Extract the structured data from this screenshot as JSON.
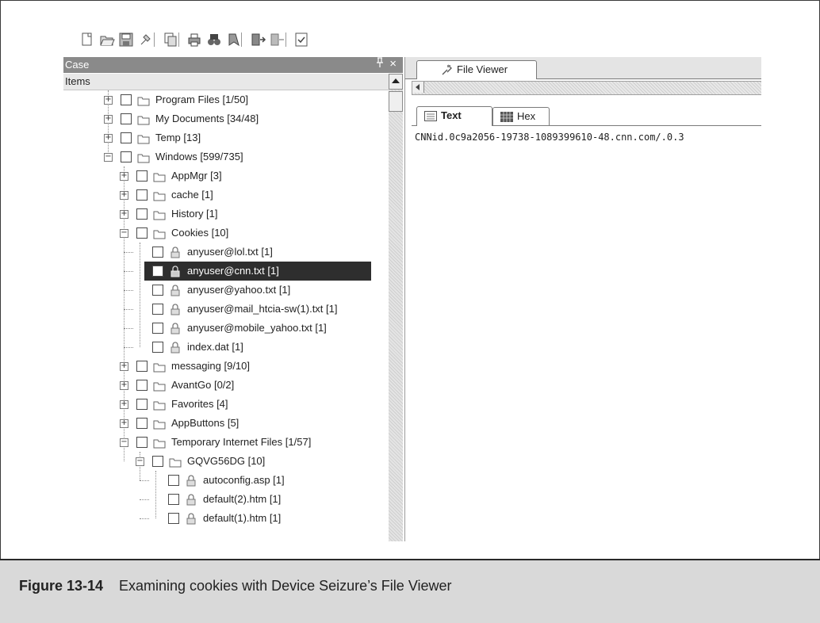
{
  "toolbar": {
    "icons": [
      "new-icon",
      "open-icon",
      "save-icon",
      "properties-icon",
      "copy-icon",
      "print-icon",
      "find-icon",
      "bookmark-icon",
      "acquire-icon",
      "disconnect-icon",
      "report-icon"
    ]
  },
  "case_panel": {
    "title": "Case",
    "pin_glyph": "ꟸ",
    "close_glyph": "×",
    "column_header": "Items"
  },
  "tree": {
    "rows": [
      {
        "label": "Program Files [1/50]",
        "kind": "folder",
        "expander": "+"
      },
      {
        "label": "My Documents [34/48]",
        "kind": "folder",
        "expander": "+"
      },
      {
        "label": "Temp [13]",
        "kind": "folder",
        "expander": "+"
      },
      {
        "label": "Windows [599/735]",
        "kind": "folder",
        "expander": "−"
      },
      {
        "label": "AppMgr [3]",
        "kind": "folder",
        "expander": "+"
      },
      {
        "label": "cache [1]",
        "kind": "folder",
        "expander": "+"
      },
      {
        "label": "History [1]",
        "kind": "folder",
        "expander": "+"
      },
      {
        "label": "Cookies [10]",
        "kind": "folder",
        "expander": "−"
      },
      {
        "label": "anyuser@lol.txt [1]",
        "kind": "file"
      },
      {
        "label": "anyuser@cnn.txt [1]",
        "kind": "file",
        "selected": true
      },
      {
        "label": "anyuser@yahoo.txt [1]",
        "kind": "file"
      },
      {
        "label": "anyuser@mail_htcia-sw(1).txt [1]",
        "kind": "file"
      },
      {
        "label": "anyuser@mobile_yahoo.txt [1]",
        "kind": "file"
      },
      {
        "label": "index.dat [1]",
        "kind": "file"
      },
      {
        "label": "messaging [9/10]",
        "kind": "folder",
        "expander": "+"
      },
      {
        "label": "AvantGo [0/2]",
        "kind": "folder",
        "expander": "+"
      },
      {
        "label": "Favorites [4]",
        "kind": "folder",
        "expander": "+"
      },
      {
        "label": "AppButtons [5]",
        "kind": "folder",
        "expander": "+"
      },
      {
        "label": "Temporary Internet Files [1/57]",
        "kind": "folder",
        "expander": "−"
      },
      {
        "label": "GQVG56DG [10]",
        "kind": "folder",
        "expander": "−"
      },
      {
        "label": "autoconfig.asp [1]",
        "kind": "file"
      },
      {
        "label": "default(2).htm [1]",
        "kind": "file"
      },
      {
        "label": "default(1).htm [1]",
        "kind": "file"
      }
    ]
  },
  "viewer": {
    "tab_label": "File Viewer",
    "sub_tabs": [
      {
        "label": "Text",
        "active": true
      },
      {
        "label": "Hex",
        "active": false
      }
    ],
    "content": "CNNid.0c9a2056-19738-1089399610-48.cnn.com/.0.3"
  },
  "caption": {
    "figure_number": "Figure 13-14",
    "title": "Examining cookies with Device Seizure’s File Viewer"
  }
}
